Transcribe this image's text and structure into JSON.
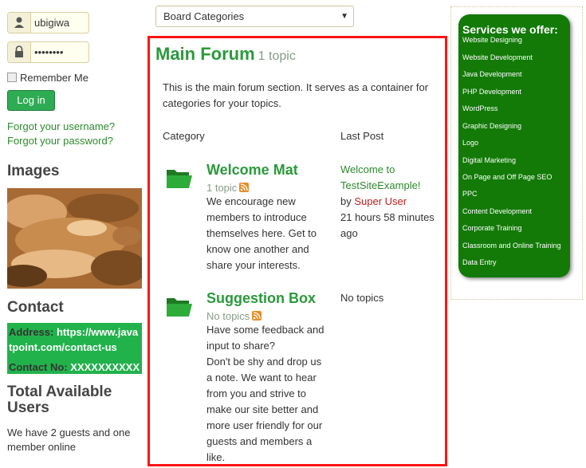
{
  "login": {
    "username_value": "ubigiwa",
    "password_value": "••••••••",
    "remember_label": "Remember Me",
    "login_label": "Log in",
    "forgot_username": "Forgot your username?",
    "forgot_password": "Forgot your password?"
  },
  "images": {
    "heading": "Images"
  },
  "contact": {
    "heading": "Contact",
    "address_label": "Address:",
    "address_value": "https://www.javatpoint.com/contact-us",
    "phone_label": "Contact No:",
    "phone_value": "XXXXXXXXXX"
  },
  "users": {
    "heading": "Total Available Users",
    "text": "We have 2 guests and one member online"
  },
  "board_select": {
    "selected": "Board Categories"
  },
  "forum": {
    "title": "Main Forum",
    "count": "1 topic",
    "description": "This is the main forum section. It serves as a container for categories for your topics.",
    "col_category": "Category",
    "col_lastpost": "Last Post",
    "categories": [
      {
        "title": "Welcome Mat",
        "count": "1 topic",
        "description": "We encourage new members to introduce themselves here. Get to know one another and share your interests.",
        "lastpost_link": "Welcome to TestSiteExample!",
        "lastpost_by": "by",
        "lastpost_user": "Super User",
        "lastpost_time": "21 hours 58 minutes ago"
      },
      {
        "title": "Suggestion Box",
        "count": "No topics",
        "description_1": "Have some feedback and input to share?",
        "description_2": "Don't be shy and drop us a note. We want to hear from you and strive to make our site better and more user friendly for our guests and members a like.",
        "lastpost_text": "No topics"
      }
    ]
  },
  "services": {
    "title": "Services we offer:",
    "items": [
      "Website Designing",
      "Website Development",
      "Java Development",
      "PHP Development",
      "WordPress",
      "Graphic Designing",
      "Logo",
      "Digital Marketing",
      "On Page and Off Page SEO",
      "PPC",
      "Content Development",
      "Corporate Training",
      "Classroom and Online Training",
      "Data Entry"
    ]
  },
  "colors": {
    "accent_green": "#2a9a3a",
    "button_green": "#2eac54",
    "services_green": "#137a08",
    "forum_border": "#ff1414",
    "user_red": "#c01f1f"
  },
  "icons": [
    "user-icon",
    "lock-icon",
    "folder-icon",
    "rss-icon",
    "dropdown-caret-icon"
  ]
}
